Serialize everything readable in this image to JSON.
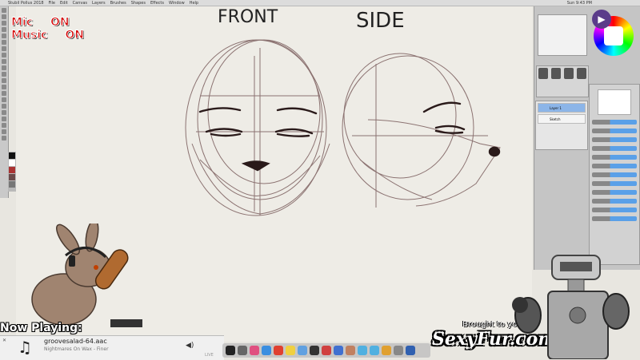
{
  "overlay": {
    "mic_label": "Mic",
    "mic_state": "ON",
    "music_label": "Music",
    "music_state": "ON",
    "now_playing_label": "Now Playing:",
    "brought_by": "Brought to you by",
    "brand": "SexyFur.com"
  },
  "app": {
    "title": "Paint Tool SAI",
    "menu": [
      "Stubil Pollus 2018",
      "File",
      "Edit",
      "Canvas",
      "Layers",
      "Brushes",
      "Shapes",
      "Effects",
      "Window",
      "Help"
    ],
    "clock": "Sun 9:43 PM"
  },
  "canvas": {
    "label_front": "FRONT",
    "label_side": "SIDE"
  },
  "music_player": {
    "file": "groovesalad-64.aac",
    "title": "Nightmares On Wax - Finer",
    "live": "LIVE"
  },
  "layers": [
    "Layer 1",
    "Sketch"
  ],
  "colors": {
    "mic_red": "#d40000",
    "sketch_line": "#6b4a4a",
    "canvas_bg": "#eeece6"
  },
  "icons": {
    "music": "music-note-icon",
    "volume": "volume-icon",
    "close": "close-icon"
  }
}
